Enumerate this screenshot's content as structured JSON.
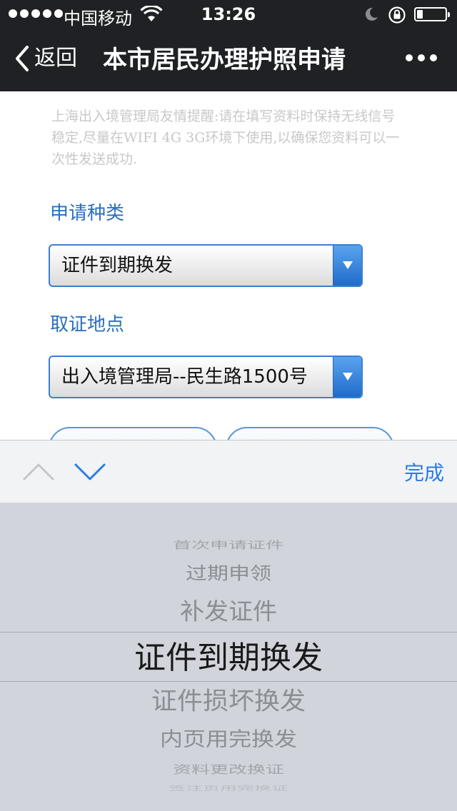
{
  "status_bar": {
    "carrier": "中国移动",
    "time": "13:26"
  },
  "nav": {
    "back_label": "返回",
    "title": "本市居民办理护照申请"
  },
  "notice": "上海出入境管理局友情提醒:请在填写资料时保持无线信号稳定,尽量在WIFI 4G 3G环境下使用,以确保您资料可以一次性发送成功.",
  "form": {
    "type_label": "申请种类",
    "type_value": "证件到期换发",
    "location_label": "取证地点",
    "location_value": "出入境管理局--民生路1500号"
  },
  "accessory": {
    "done_label": "完成"
  },
  "picker": {
    "items": [
      "首次申请证件",
      "过期申领",
      "补发证件",
      "证件到期换发",
      "证件损坏换发",
      "内页用完换发",
      "资料更改换证",
      "签注页用完换证"
    ],
    "selected_value": "证件到期换发"
  },
  "colors": {
    "nav_bg": "#1f2124",
    "accent_blue": "#2a6fbe",
    "done_blue": "#2a7de1",
    "picker_bg": "#d1d4db"
  }
}
